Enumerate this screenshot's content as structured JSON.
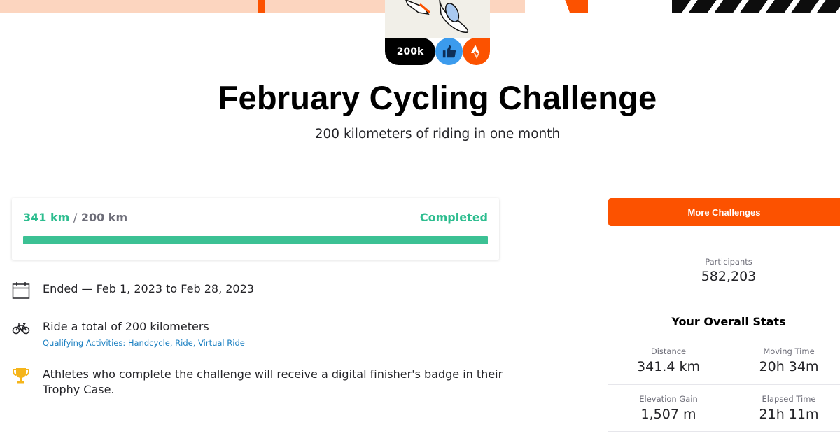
{
  "badge": {
    "count": "200k",
    "like_icon": "thumbs-up-icon",
    "brand_icon": "strava-logo-icon"
  },
  "challenge": {
    "title": "February Cycling Challenge",
    "subtitle": "200 kilometers of riding in one month"
  },
  "progress": {
    "completed_value": "341 km",
    "separator": "/",
    "goal_value": "200 km",
    "status": "Completed",
    "fill_fraction": 1.0,
    "fill_color": "#3cc194"
  },
  "details": {
    "dates": "Ended — Feb 1, 2023 to Feb 28, 2023",
    "goal": "Ride a total of 200 kilometers",
    "qualifying": "Qualifying Activities: Handcycle, Ride, Virtual Ride",
    "reward": "Athletes who complete the challenge will receive a digital finisher's badge in their Trophy Case."
  },
  "sidebar": {
    "more_button": "More Challenges",
    "participants_label": "Participants",
    "participants_value": "582,203",
    "stats_heading": "Your Overall Stats",
    "stats": [
      {
        "label": "Distance",
        "value": "341.4 km"
      },
      {
        "label": "Moving Time",
        "value": "20h 34m"
      },
      {
        "label": "Elevation Gain",
        "value": "1,507 m"
      },
      {
        "label": "Elapsed Time",
        "value": "21h 11m"
      }
    ]
  },
  "colors": {
    "brand_orange": "#fc5200",
    "success_green": "#2dbd8f",
    "link_blue": "#1a7fc1",
    "trophy_gold": "#f5b51b"
  }
}
